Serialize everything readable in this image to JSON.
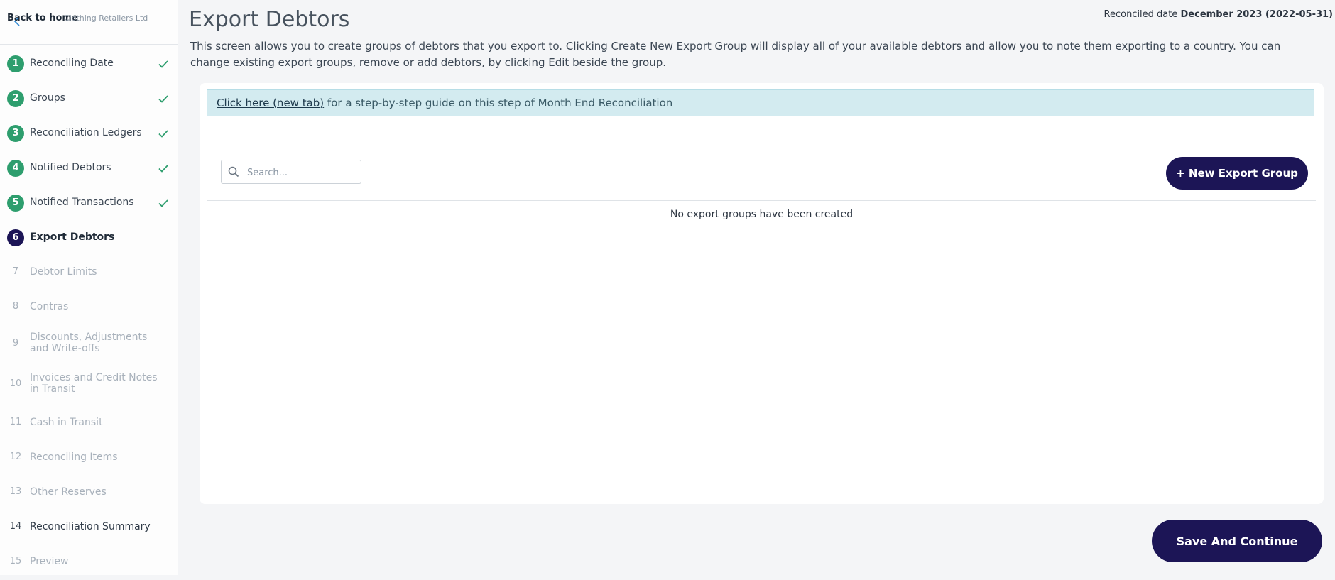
{
  "sidebar": {
    "back_label": "Back to home",
    "company": "Clothing Retailers Ltd",
    "steps": [
      {
        "number": "1",
        "label": "Reconciling Date",
        "state": "done"
      },
      {
        "number": "2",
        "label": "Groups",
        "state": "done"
      },
      {
        "number": "3",
        "label": "Reconciliation Ledgers",
        "state": "done"
      },
      {
        "number": "4",
        "label": "Notified Debtors",
        "state": "done"
      },
      {
        "number": "5",
        "label": "Notified Transactions",
        "state": "done"
      },
      {
        "number": "6",
        "label": "Export Debtors",
        "state": "active"
      },
      {
        "number": "7",
        "label": "Debtor Limits",
        "state": "pending"
      },
      {
        "number": "8",
        "label": "Contras",
        "state": "pending"
      },
      {
        "number": "9",
        "label": "Discounts, Adjustments and Write-offs",
        "state": "pending"
      },
      {
        "number": "10",
        "label": "Invoices and Credit Notes in Transit",
        "state": "pending"
      },
      {
        "number": "11",
        "label": "Cash in Transit",
        "state": "pending"
      },
      {
        "number": "12",
        "label": "Reconciling Items",
        "state": "pending"
      },
      {
        "number": "13",
        "label": "Other Reserves",
        "state": "pending"
      },
      {
        "number": "14",
        "label": "Reconciliation Summary",
        "state": "available"
      },
      {
        "number": "15",
        "label": "Preview",
        "state": "pending"
      }
    ]
  },
  "header": {
    "title": "Export Debtors",
    "reconciled_label": "Reconciled date",
    "reconciled_value": "December 2023 (2022-05-31)",
    "description": "This screen allows you to create groups of debtors that you export to. Clicking Create New Export Group will display all of your available debtors and allow you to note them exporting to a country. You can change existing export groups, remove or add debtors, by clicking Edit beside the group."
  },
  "guide": {
    "link_text": "Click here (new tab)",
    "rest_text": " for a step-by-step guide on this step of Month End Reconciliation"
  },
  "toolbar": {
    "search_placeholder": "Search...",
    "search_value": "",
    "new_group_label": "+ New Export Group"
  },
  "empty_message": "No export groups have been created",
  "footer": {
    "save_label": "Save And Continue"
  },
  "colors": {
    "primary": "#1c1556",
    "done": "#2e9e6e",
    "banner_bg": "#d3ebf0"
  }
}
